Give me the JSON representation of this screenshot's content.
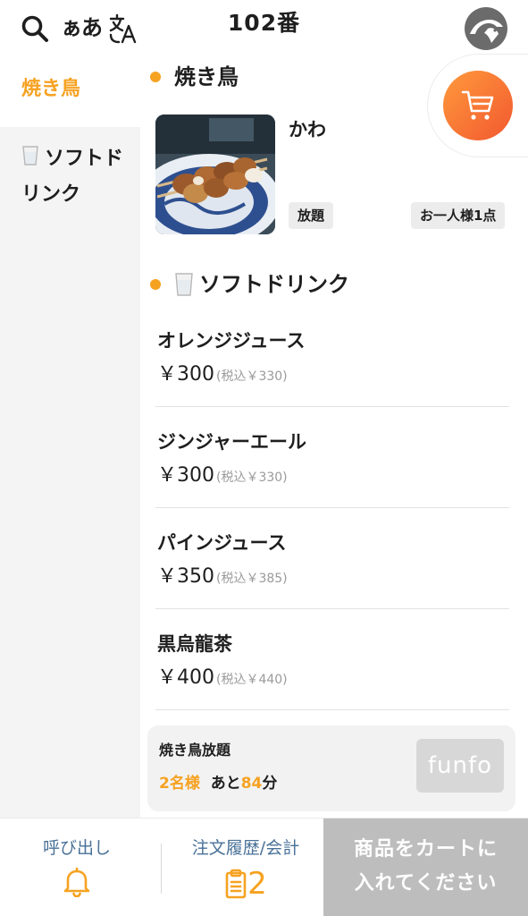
{
  "header": {
    "kana_toggle": "ぁあ",
    "table_label": "102番"
  },
  "sidebar": {
    "items": [
      {
        "label": "焼き鳥",
        "active": true
      },
      {
        "label": "ソフトドリンク",
        "icon": "cup-icon",
        "active": false
      }
    ]
  },
  "sections": [
    {
      "title": "焼き鳥",
      "items": [
        {
          "name": "かわ",
          "tag_left": "放題",
          "tag_right": "お一人様1点"
        }
      ]
    },
    {
      "title": "ソフトドリンク",
      "icon": "cup-icon",
      "items": [
        {
          "name": "オレンジジュース",
          "price": "￥300",
          "tax": "(税込￥330)"
        },
        {
          "name": "ジンジャーエール",
          "price": "￥300",
          "tax": "(税込￥330)"
        },
        {
          "name": "パインジュース",
          "price": "￥350",
          "tax": "(税込￥385)"
        },
        {
          "name": "黒烏龍茶",
          "price": "￥400",
          "tax": "(税込￥440)"
        }
      ]
    }
  ],
  "plan": {
    "title": "焼き鳥放題",
    "guests": "2名様",
    "remaining_prefix": "あと",
    "remaining_minutes": "84",
    "remaining_suffix": "分",
    "logo_text": "funfo"
  },
  "bottom_bar": {
    "call_label": "呼び出し",
    "history_label": "注文履歴/会計",
    "history_count": "2",
    "cart_cta_line1": "商品をカートに",
    "cart_cta_line2": "入れてください"
  },
  "colors": {
    "accent": "#f6a221",
    "cart_gradient_start": "#ff9a3c",
    "cart_gradient_end": "#f2582f",
    "link_blue": "#4a7298",
    "cta_disabled": "#bdbdbd"
  }
}
